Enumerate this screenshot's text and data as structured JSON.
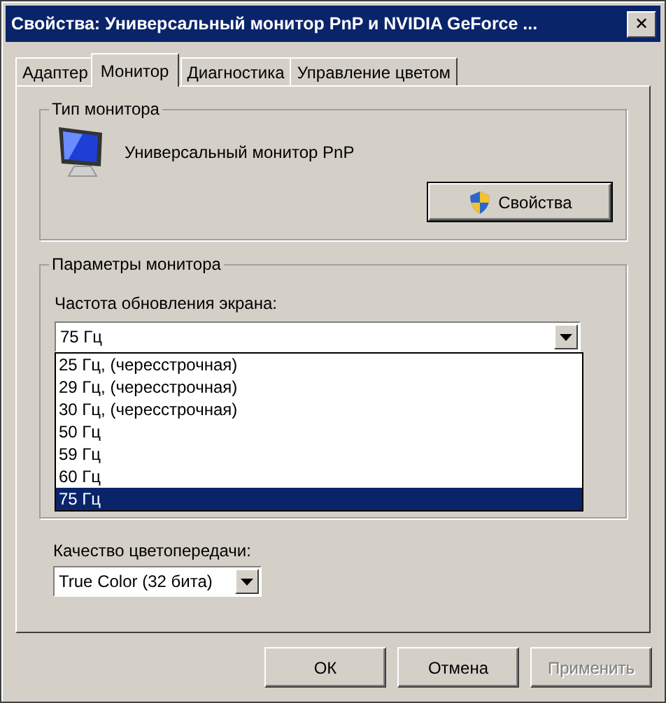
{
  "window": {
    "title": "Свойства: Универсальный монитор PnP и NVIDIA GeForce ...",
    "close": "✕"
  },
  "tabs": [
    {
      "label": "Адаптер",
      "selected": false
    },
    {
      "label": "Монитор",
      "selected": true
    },
    {
      "label": "Диагностика",
      "selected": false
    },
    {
      "label": "Управление цветом",
      "selected": false
    }
  ],
  "monitor_type": {
    "title": "Тип монитора",
    "name": "Универсальный монитор PnP",
    "button": "Свойства"
  },
  "monitor_settings": {
    "title": "Параметры монитора",
    "refresh_label": "Частота обновления экрана:",
    "refresh_value": "75 Гц",
    "refresh_options": [
      {
        "label": "25 Гц, (чересстрочная)",
        "selected": false
      },
      {
        "label": "29 Гц, (чересстрочная)",
        "selected": false
      },
      {
        "label": "30 Гц, (чересстрочная)",
        "selected": false
      },
      {
        "label": "50 Гц",
        "selected": false
      },
      {
        "label": "59 Гц",
        "selected": false
      },
      {
        "label": "60 Гц",
        "selected": false
      },
      {
        "label": "75 Гц",
        "selected": true
      }
    ]
  },
  "color_quality": {
    "label": "Качество цветопередачи:",
    "value": "True Color (32 бита)"
  },
  "buttons": [
    {
      "label": "ОК",
      "disabled": false
    },
    {
      "label": "Отмена",
      "disabled": false
    },
    {
      "label": "Применить",
      "disabled": true
    }
  ]
}
